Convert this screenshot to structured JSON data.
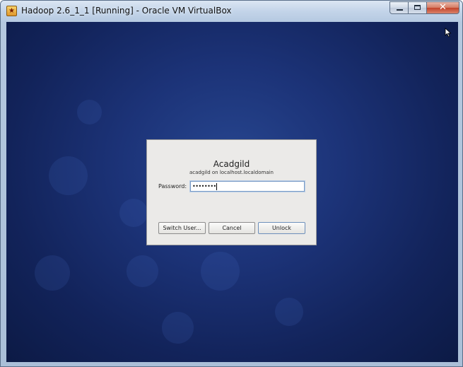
{
  "window": {
    "title": "Hadoop 2.6_1_1 [Running] - Oracle VM VirtualBox",
    "icon": "virtualbox-app-icon",
    "controls": {
      "minimize_icon": "minimize-icon",
      "maximize_icon": "maximize-icon",
      "close_icon": "close-icon",
      "close_glyph": "✕"
    }
  },
  "lock_dialog": {
    "user_name": "Acadgild",
    "host_line": "acadgild on localhost.localdomain",
    "password_label": "Password:",
    "password_mask": "••••••••",
    "buttons": {
      "switch_user": "Switch User...",
      "cancel": "Cancel",
      "unlock": "Unlock"
    }
  },
  "colors": {
    "desktop_background": "#1c3378",
    "dialog_background": "#ebeae8",
    "titlebar": "#c3d4e9",
    "close_button": "#c3432a"
  }
}
